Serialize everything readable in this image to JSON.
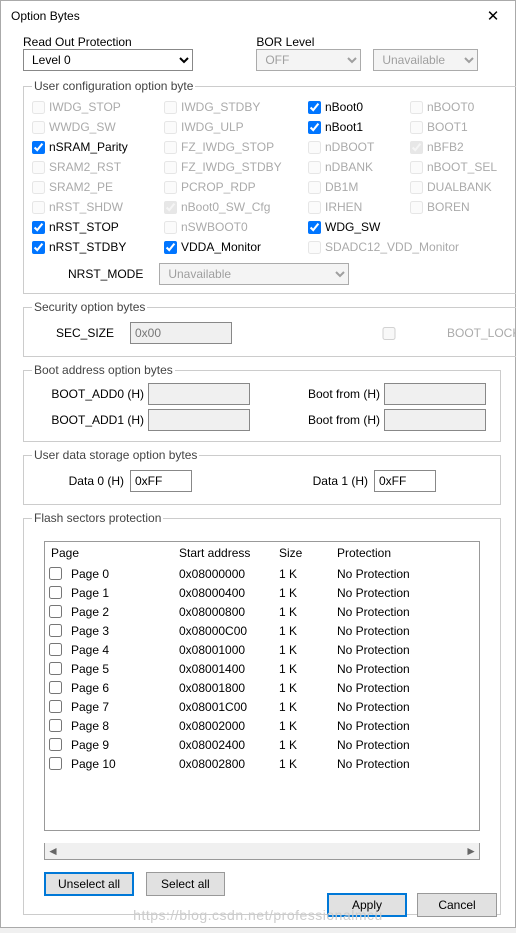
{
  "window": {
    "title": "Option Bytes"
  },
  "rop": {
    "legend": "Read Out Protection",
    "value": "Level 0"
  },
  "bor": {
    "legend": "BOR Level",
    "value": "OFF",
    "unavail": "Unavailable"
  },
  "ucob": {
    "legend": "User configuration option byte",
    "items": [
      {
        "label": "IWDG_STOP",
        "checked": false,
        "enabled": false
      },
      {
        "label": "IWDG_STDBY",
        "checked": false,
        "enabled": false
      },
      {
        "label": "nBoot0",
        "checked": true,
        "enabled": true
      },
      {
        "label": "nBOOT0",
        "checked": false,
        "enabled": false
      },
      {
        "label": "WWDG_SW",
        "checked": false,
        "enabled": false
      },
      {
        "label": "IWDG_ULP",
        "checked": false,
        "enabled": false
      },
      {
        "label": "nBoot1",
        "checked": true,
        "enabled": true
      },
      {
        "label": "BOOT1",
        "checked": false,
        "enabled": false
      },
      {
        "label": "nSRAM_Parity",
        "checked": true,
        "enabled": true
      },
      {
        "label": "FZ_IWDG_STOP",
        "checked": false,
        "enabled": false
      },
      {
        "label": "nDBOOT",
        "checked": false,
        "enabled": false
      },
      {
        "label": "nBFB2",
        "checked": true,
        "enabled": false
      },
      {
        "label": "SRAM2_RST",
        "checked": false,
        "enabled": false
      },
      {
        "label": "FZ_IWDG_STDBY",
        "checked": false,
        "enabled": false
      },
      {
        "label": "nDBANK",
        "checked": false,
        "enabled": false
      },
      {
        "label": "nBOOT_SEL",
        "checked": false,
        "enabled": false
      },
      {
        "label": "SRAM2_PE",
        "checked": false,
        "enabled": false
      },
      {
        "label": "PCROP_RDP",
        "checked": false,
        "enabled": false
      },
      {
        "label": "DB1M",
        "checked": false,
        "enabled": false
      },
      {
        "label": "DUALBANK",
        "checked": false,
        "enabled": false
      },
      {
        "label": "nRST_SHDW",
        "checked": false,
        "enabled": false
      },
      {
        "label": "nBoot0_SW_Cfg",
        "checked": true,
        "enabled": false
      },
      {
        "label": "IRHEN",
        "checked": false,
        "enabled": false
      },
      {
        "label": "BOREN",
        "checked": false,
        "enabled": false
      },
      {
        "label": "nRST_STOP",
        "checked": true,
        "enabled": true
      },
      {
        "label": "nSWBOOT0",
        "checked": false,
        "enabled": false
      },
      {
        "label": "WDG_SW",
        "checked": true,
        "enabled": true
      },
      {
        "label": "",
        "checked": false,
        "enabled": false,
        "hidden": true
      },
      {
        "label": "nRST_STDBY",
        "checked": true,
        "enabled": true
      },
      {
        "label": "VDDA_Monitor",
        "checked": true,
        "enabled": true
      },
      {
        "label": "SDADC12_VDD_Monitor",
        "checked": false,
        "enabled": false,
        "span": 2
      }
    ],
    "nrst_label": "NRST_MODE",
    "nrst_value": "Unavailable"
  },
  "sec": {
    "legend": "Security option bytes",
    "size_label": "SEC_SIZE",
    "size_value": "0x00",
    "bootlock": "BOOT_LOCK"
  },
  "boot": {
    "legend": "Boot address option bytes",
    "add0_label": "BOOT_ADD0 (H)",
    "add0_value": "",
    "bootfrom0_label": "Boot from (H)",
    "bootfrom0_value": "",
    "add1_label": "BOOT_ADD1 (H)",
    "add1_value": "",
    "bootfrom1_label": "Boot from (H)",
    "bootfrom1_value": ""
  },
  "udata": {
    "legend": "User data storage option bytes",
    "d0_label": "Data 0 (H)",
    "d0_value": "0xFF",
    "d1_label": "Data 1 (H)",
    "d1_value": "0xFF"
  },
  "flash": {
    "legend": "Flash sectors protection",
    "headers": {
      "page": "Page",
      "addr": "Start address",
      "size": "Size",
      "prot": "Protection"
    },
    "rows": [
      {
        "page": "Page 0",
        "addr": "0x08000000",
        "size": "1 K",
        "prot": "No Protection"
      },
      {
        "page": "Page 1",
        "addr": "0x08000400",
        "size": "1 K",
        "prot": "No Protection"
      },
      {
        "page": "Page 2",
        "addr": "0x08000800",
        "size": "1 K",
        "prot": "No Protection"
      },
      {
        "page": "Page 3",
        "addr": "0x08000C00",
        "size": "1 K",
        "prot": "No Protection"
      },
      {
        "page": "Page 4",
        "addr": "0x08001000",
        "size": "1 K",
        "prot": "No Protection"
      },
      {
        "page": "Page 5",
        "addr": "0x08001400",
        "size": "1 K",
        "prot": "No Protection"
      },
      {
        "page": "Page 6",
        "addr": "0x08001800",
        "size": "1 K",
        "prot": "No Protection"
      },
      {
        "page": "Page 7",
        "addr": "0x08001C00",
        "size": "1 K",
        "prot": "No Protection"
      },
      {
        "page": "Page 8",
        "addr": "0x08002000",
        "size": "1 K",
        "prot": "No Protection"
      },
      {
        "page": "Page 9",
        "addr": "0x08002400",
        "size": "1 K",
        "prot": "No Protection"
      },
      {
        "page": "Page 10",
        "addr": "0x08002800",
        "size": "1 K",
        "prot": "No Protection"
      }
    ],
    "unselect": "Unselect all",
    "select": "Select all"
  },
  "buttons": {
    "apply": "Apply",
    "cancel": "Cancel"
  },
  "watermark": "https://blog.csdn.net/professionalmcu"
}
